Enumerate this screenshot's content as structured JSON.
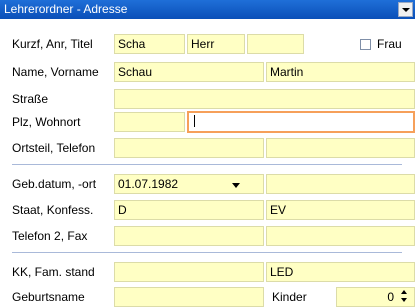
{
  "window": {
    "title": "Lehrerordner - Adresse"
  },
  "labels": {
    "kurzf": "Kurzf, Anr, Titel",
    "name": "Name, Vorname",
    "strasse": "Straße",
    "plz": "Plz, Wohnort",
    "ortsteil": "Ortsteil, Telefon",
    "geb": "Geb.datum, -ort",
    "staat": "Staat, Konfess.",
    "telefon2": "Telefon 2, Fax",
    "kk": "KK, Fam. stand",
    "geburtsname": "Geburtsname",
    "frau": "Frau",
    "kinder": "Kinder"
  },
  "fields": {
    "kurzform": "Scha",
    "anrede": "Herr",
    "titel": "",
    "name": "Schau",
    "vorname": "Martin",
    "strasse": "",
    "plz": "",
    "wohnort": "",
    "ortsteil": "",
    "telefon": "",
    "geburtsdatum": "01.07.1982",
    "geburtsort": "",
    "staat": "D",
    "konfession": "EV",
    "telefon2": "",
    "fax": "",
    "kk": "",
    "familienstand": "LED",
    "geburtsname": "",
    "kinder": "0"
  },
  "checkbox": {
    "frau_checked": false
  },
  "icons": {
    "title_dropdown": "chevron-down-icon",
    "date_dropdown": "chevron-down-icon",
    "spinner": "spinner-up-down-icon"
  },
  "colors": {
    "field_bg": "#ffffc4",
    "focus_border": "#f6a05a",
    "title_bg": "#0a4fb8",
    "separator": "#a9b9d9"
  }
}
